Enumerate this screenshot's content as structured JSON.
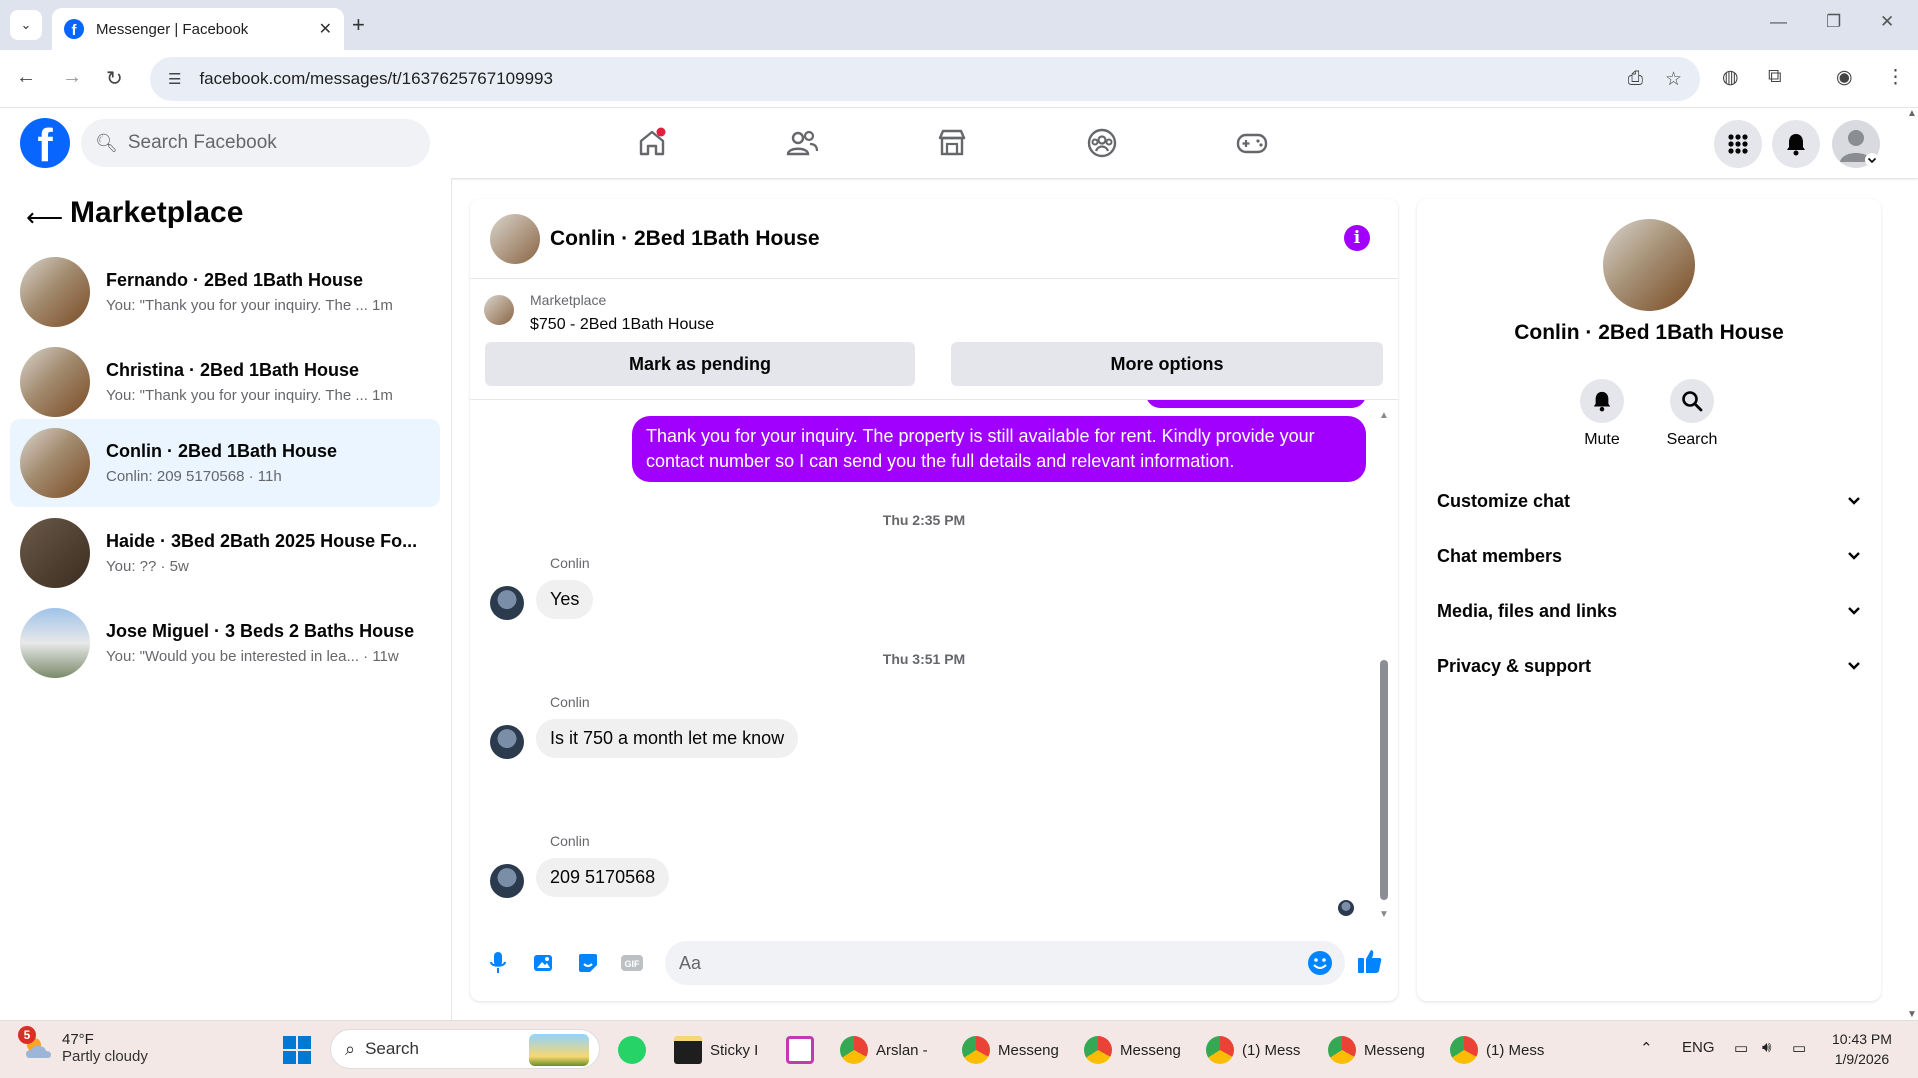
{
  "browser": {
    "tab_title": "Messenger | Facebook",
    "favicon": "f",
    "url": "facebook.com/messages/t/1637625767109993"
  },
  "fb": {
    "logo": "f",
    "search_placeholder": "Search Facebook"
  },
  "marketplace": {
    "title": "Marketplace",
    "conversations": [
      {
        "name": "Fernando · 2Bed 1Bath House",
        "preview": "You: \"Thank you for your inquiry. The ... 1m"
      },
      {
        "name": "Christina · 2Bed 1Bath House",
        "preview": "You: \"Thank you for your inquiry. The ... 1m"
      },
      {
        "name": "Conlin · 2Bed 1Bath House",
        "preview": "Conlin: 209 5170568 · 11h"
      },
      {
        "name": "Haide · 3Bed 2Bath 2025 House Fo...",
        "preview": "You: ?? · 5w"
      },
      {
        "name": "Jose Miguel · 3 Beds 2 Baths House",
        "preview": "You: \"Would you be interested in lea... · 11w"
      }
    ]
  },
  "chat": {
    "title": "Conlin · 2Bed 1Bath House",
    "info_icon": "i",
    "listing_label": "Marketplace",
    "listing_price": "$750 - 2Bed 1Bath House",
    "mark_pending": "Mark as pending",
    "more_options": "More options",
    "outgoing": "Thank you for your inquiry. The property is still available for rent. Kindly provide your contact number so I can send you the full details and relevant information.",
    "ts1": "Thu 2:35 PM",
    "sender": "Conlin",
    "msg1": "Yes",
    "ts2": "Thu 3:51 PM",
    "msg2": "Is it 750 a month let me know",
    "msg3": "209 5170568",
    "composer_placeholder": "Aa"
  },
  "details": {
    "name": "Conlin · 2Bed 1Bath House",
    "mute": "Mute",
    "search": "Search",
    "sections": [
      "Customize chat",
      "Chat members",
      "Media, files and links",
      "Privacy & support"
    ]
  },
  "taskbar": {
    "weather_badge": "5",
    "temp": "47°F",
    "condition": "Partly cloudy",
    "search": "Search",
    "apps": [
      "Sticky I",
      "Arslan -",
      "Messeng",
      "Messeng",
      "(1) Mess",
      "Messeng",
      "(1) Mess"
    ],
    "lang": "ENG",
    "time": "10:43 PM",
    "date": "1/9/2026"
  },
  "colors": {
    "fb_blue": "#0866ff",
    "messenger_purple": "#a100ff",
    "active_row": "#ebf5ff"
  }
}
